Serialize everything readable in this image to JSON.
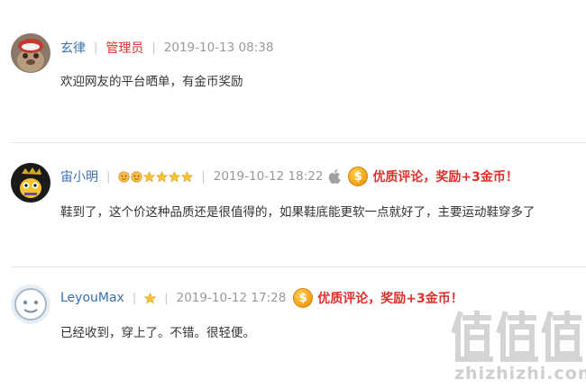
{
  "comments": [
    {
      "username": "玄律",
      "role": "管理员",
      "timestamp": "2019-10-13 08:38",
      "text": "欢迎网友的平台晒单，有金币奖励"
    },
    {
      "username": "宙小明",
      "timestamp": "2019-10-12 18:22",
      "device_icon": "apple-icon",
      "reward_text": "优质评论，奖励+3金币！",
      "badges": [
        "level-face-icon",
        "level-face-icon",
        "star-icon",
        "star-icon",
        "star-icon",
        "star-icon"
      ],
      "text": "鞋到了，这个价这种品质还是很值得的，如果鞋底能更软一点就好了，主要运动鞋穿多了"
    },
    {
      "username": "LeyouMax",
      "timestamp": "2019-10-12 17:28",
      "reward_text": "优质评论，奖励+3金币！",
      "badges": [
        "star-icon"
      ],
      "text": "已经收到，穿上了。不错。很轻便。"
    }
  ],
  "coin_symbol": "$",
  "watermark": {
    "logo": "值值值",
    "text": "zhizhizhi.com"
  },
  "colors": {
    "username": "#3a6fb0",
    "role": "#e0302c",
    "reward": "#e0302c",
    "timestamp": "#999999",
    "coin": "#f5a41c"
  }
}
